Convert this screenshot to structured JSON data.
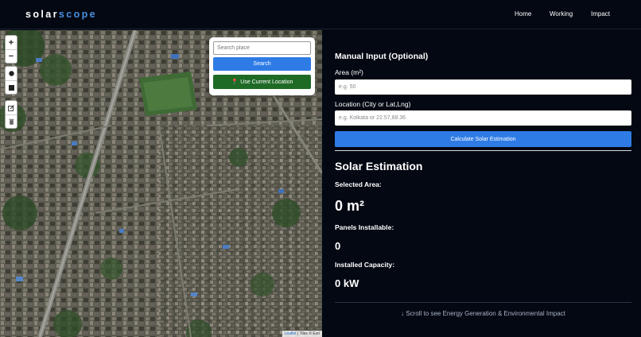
{
  "brand": {
    "part1": "solar",
    "part2": "scope"
  },
  "nav": {
    "home": "Home",
    "working": "Working",
    "impact": "Impact"
  },
  "map": {
    "zoom_in": "+",
    "zoom_out": "−",
    "search": {
      "placeholder": "Search place",
      "search_label": "Search",
      "location_label": "Use Current Location"
    },
    "attribution_link": "Leaflet",
    "attribution_rest": " | Tiles © Esri"
  },
  "manual_input": {
    "heading": "Manual Input (Optional)",
    "area_label": "Area (m²)",
    "area_placeholder": "e.g. 50",
    "location_label": "Location (City or Lat,Lng)",
    "location_placeholder": "e.g. Kolkata or 22.57,88.36",
    "calculate_label": "Calculate Solar Estimation"
  },
  "estimation": {
    "heading": "Solar Estimation",
    "selected_area_label": "Selected Area:",
    "selected_area_value": "0 m²",
    "panels_label": "Panels Installable:",
    "panels_value": "0",
    "capacity_label": "Installed Capacity:",
    "capacity_value": "0 kW",
    "scroll_hint": "↓ Scroll to see Energy Generation & Environmental Impact"
  },
  "colors": {
    "accent_blue": "#2f7be6",
    "location_green": "#1f6b26",
    "background": "#030812"
  }
}
